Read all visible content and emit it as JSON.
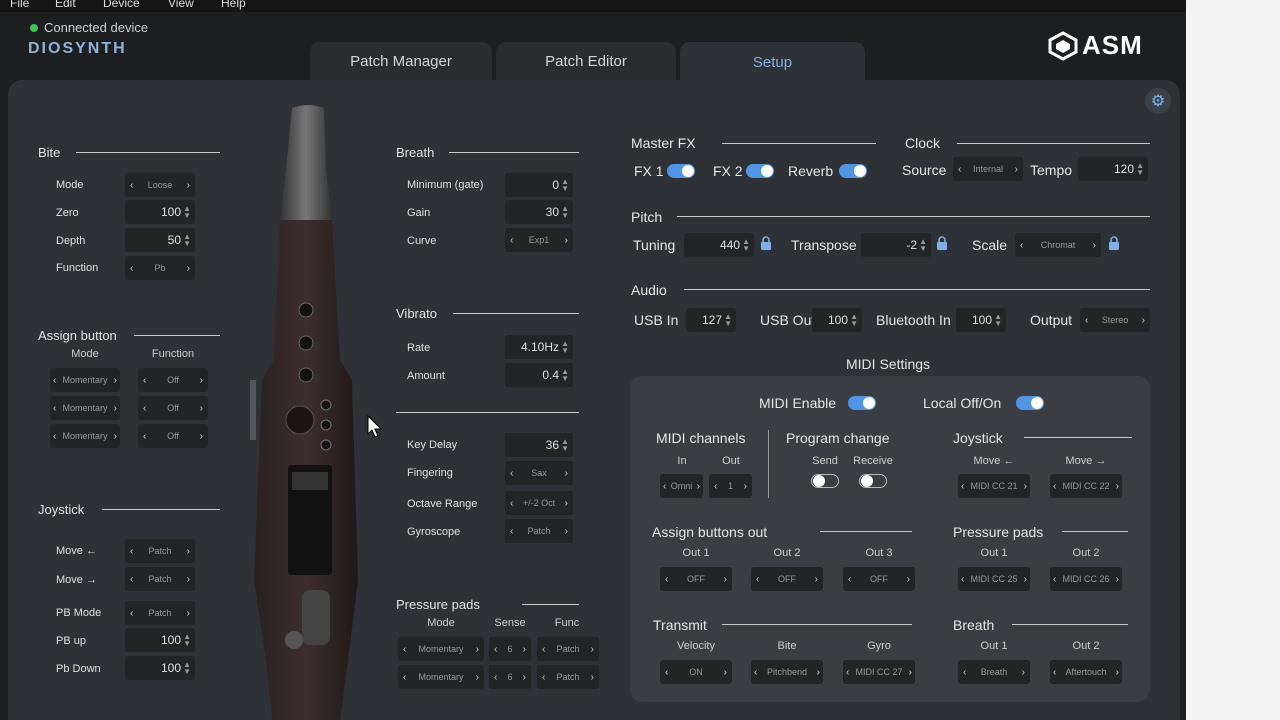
{
  "menu": [
    "File",
    "Edit",
    "Device",
    "View",
    "Help"
  ],
  "status": {
    "connected_label": "Connected device",
    "brand": "DIOSYNTH"
  },
  "tabs": [
    {
      "label": "Patch Manager"
    },
    {
      "label": "Patch Editor"
    },
    {
      "label": "Setup"
    }
  ],
  "logo": "ASM",
  "colors": {
    "accent": "#4f97e6",
    "panel": "#2e3135",
    "midi_panel": "#3a3d41"
  },
  "bite": {
    "title": "Bite",
    "mode_label": "Mode",
    "mode": "Loose",
    "zero_label": "Zero",
    "zero": "100",
    "depth_label": "Depth",
    "depth": "50",
    "function_label": "Function",
    "function": "Pb"
  },
  "assign": {
    "title": "Assign button",
    "mode_hdr": "Mode",
    "func_hdr": "Function",
    "rows": [
      {
        "mode": "Momentary",
        "func": "Off"
      },
      {
        "mode": "Momentary",
        "func": "Off"
      },
      {
        "mode": "Momentary",
        "func": "Off"
      }
    ]
  },
  "joystick": {
    "title": "Joystick",
    "move_l_label": "Move ←",
    "move_l": "Patch",
    "move_r_label": "Move →",
    "move_r": "Patch",
    "pbmode_label": "PB Mode",
    "pbmode": "Patch",
    "pbup_label": "PB up",
    "pbup": "100",
    "pbdown_label": "Pb Down",
    "pbdown": "100"
  },
  "breath": {
    "title": "Breath",
    "min_label": "Minimum (gate)",
    "min": "0",
    "gain_label": "Gain",
    "gain": "30",
    "curve_label": "Curve",
    "curve": "Exp1"
  },
  "vibrato": {
    "title": "Vibrato",
    "rate_label": "Rate",
    "rate": "4.10Hz",
    "amount_label": "Amount",
    "amount": "0.4"
  },
  "keys": {
    "keydelay_label": "Key Delay",
    "keydelay": "36",
    "fingering_label": "Fingering",
    "fingering": "Sax",
    "octave_label": "Octave Range",
    "octave": "+/-2 Oct",
    "gyro_label": "Gyroscope",
    "gyro": "Patch"
  },
  "pads": {
    "title": "Pressure pads",
    "mode_hdr": "Mode",
    "sense_hdr": "Sense",
    "func_hdr": "Func",
    "rows": [
      {
        "mode": "Momentary",
        "sense": "6",
        "func": "Patch"
      },
      {
        "mode": "Momentary",
        "sense": "6",
        "func": "Patch"
      }
    ]
  },
  "masterfx": {
    "title": "Master FX",
    "fx1": "FX 1",
    "fx2": "FX 2",
    "reverb": "Reverb"
  },
  "clock": {
    "title": "Clock",
    "source_label": "Source",
    "source": "Internal",
    "tempo_label": "Tempo",
    "tempo": "120"
  },
  "pitch": {
    "title": "Pitch",
    "tuning_label": "Tuning",
    "tuning": "440",
    "transpose_label": "Transpose",
    "transpose": "-2",
    "scale_label": "Scale",
    "scale": "Chromat"
  },
  "audio": {
    "title": "Audio",
    "usbin_label": "USB In",
    "usbin": "127",
    "usbout_label": "USB Out",
    "usbout": "100",
    "btin_label": "Bluetooth In",
    "btin": "100",
    "output_label": "Output",
    "output": "Stereo"
  },
  "midi": {
    "title": "MIDI Settings",
    "enable_label": "MIDI Enable",
    "local_label": "Local Off/On",
    "channels_title": "MIDI channels",
    "in_hdr": "In",
    "out_hdr": "Out",
    "in": "Omni",
    "out": "1",
    "pc_title": "Program change",
    "send_hdr": "Send",
    "receive_hdr": "Receive",
    "joy_title": "Joystick",
    "joy_l_hdr": "Move ←",
    "joy_r_hdr": "Move →",
    "joy_l": "MIDI CC 21",
    "joy_r": "MIDI CC 22",
    "assign_title": "Assign buttons out",
    "out1_hdr": "Out 1",
    "out2_hdr": "Out 2",
    "out3_hdr": "Out 3",
    "a1": "OFF",
    "a2": "OFF",
    "a3": "OFF",
    "pads_title": "Pressure pads",
    "p1": "MIDI CC 25",
    "p2": "MIDI CC 26",
    "transmit_title": "Transmit",
    "vel_hdr": "Velocity",
    "bite_hdr": "Bite",
    "gyro_hdr": "Gyro",
    "vel": "ON",
    "bite": "Pitchbend",
    "gyro": "MIDI CC 27",
    "breath_title": "Breath",
    "b1": "Breath",
    "b2": "Aftertouch"
  }
}
